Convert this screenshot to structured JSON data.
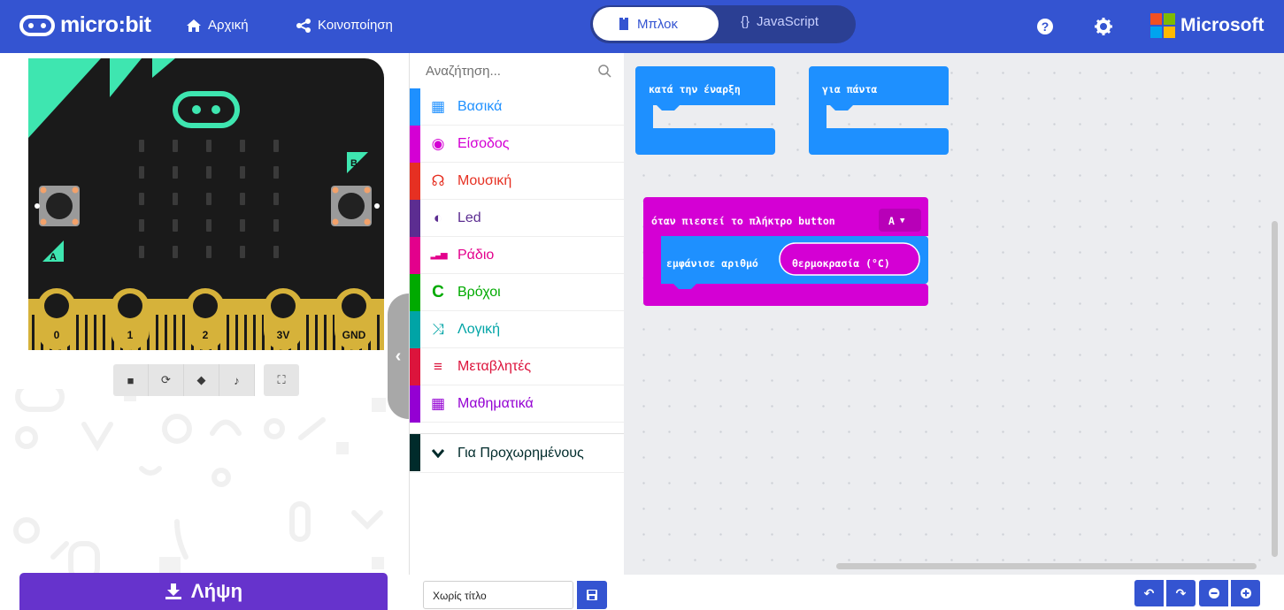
{
  "header": {
    "brand": "micro:bit",
    "home_label": "Αρχική",
    "share_label": "Κοινοποίηση",
    "blocks_tab": "Μπλοκ",
    "js_tab": "JavaScript",
    "js_icon": "{}",
    "microsoft": "Microsoft",
    "colors": {
      "bar": "#3454d1"
    }
  },
  "simulator": {
    "button_a": "A",
    "button_b": "B",
    "pins": [
      "0",
      "1",
      "2",
      "3V",
      "GND"
    ],
    "tools": [
      "stop-icon",
      "restart-icon",
      "slowmo-icon",
      "mute-icon",
      "fullscreen-icon"
    ]
  },
  "download": {
    "label": "Λήψη"
  },
  "toolbox": {
    "search_placeholder": "Αναζήτηση...",
    "categories": [
      {
        "label": "Βασικά",
        "color": "#1e90ff",
        "icon": "grid-icon"
      },
      {
        "label": "Είσοδος",
        "color": "#d400d4",
        "icon": "input-icon"
      },
      {
        "label": "Μουσική",
        "color": "#e63022",
        "icon": "headphones-icon"
      },
      {
        "label": "Led",
        "color": "#5c2d91",
        "icon": "toggle-icon"
      },
      {
        "label": "Ράδιο",
        "color": "#e3008c",
        "icon": "signal-icon"
      },
      {
        "label": "Βρόχοι",
        "color": "#00aa00",
        "icon": "loop-icon"
      },
      {
        "label": "Λογική",
        "color": "#00a4a6",
        "icon": "shuffle-icon"
      },
      {
        "label": "Μεταβλητές",
        "color": "#dc143c",
        "icon": "list-icon"
      },
      {
        "label": "Μαθηματικά",
        "color": "#9400d3",
        "icon": "calculator-icon"
      }
    ],
    "advanced": {
      "label": "Για Προχωρημένους",
      "color": "#002b2b"
    }
  },
  "workspace": {
    "on_start": "κατά την έναρξη",
    "forever": "για πάντα",
    "on_button": "όταν πιεστεί το πλήκτρο button",
    "button_value": "A",
    "show_number": "εμφάνισε αριθμό",
    "temperature": "θερμοκρασία (°C)"
  },
  "bottom": {
    "project_name": "Χωρίς τίτλο"
  }
}
